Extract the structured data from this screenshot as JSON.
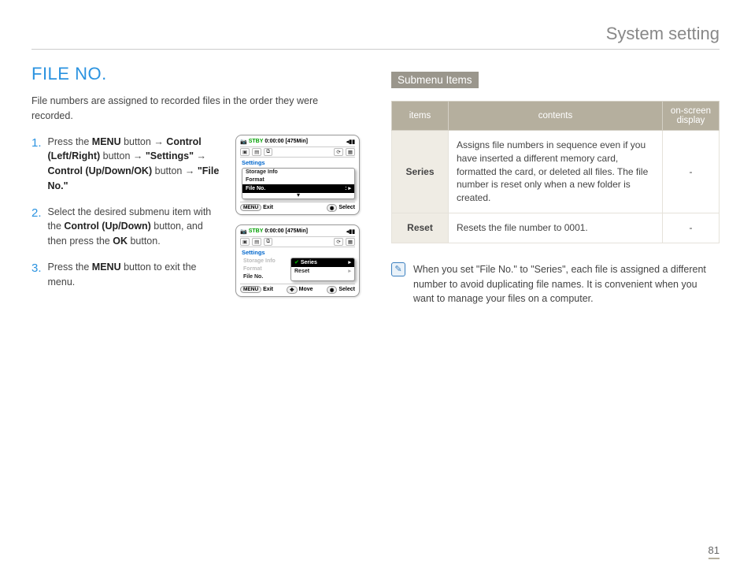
{
  "header": {
    "title": "System setting"
  },
  "section": {
    "title": "FILE NO."
  },
  "intro": "File numbers are assigned to recorded files in the order they were recorded.",
  "steps": [
    {
      "num": "1.",
      "pre": "Press the ",
      "b1": "MENU",
      "mid1": " button ",
      "arr1": "→",
      "b2": " Control (Left/Right)",
      "mid2": " button ",
      "arr2": "→",
      "q1": " \"Settings\" ",
      "arr3": "→",
      "b3": " Control (Up/Down/OK)",
      "mid3": " button ",
      "arr4": "→",
      "q2": " \"File No.\""
    },
    {
      "num": "2.",
      "text1": "Select the desired submenu item with the ",
      "b1": "Control (Up/Down)",
      "text2": " button, and then press the ",
      "b2": "OK",
      "text3": " button."
    },
    {
      "num": "3.",
      "text1": "Press the ",
      "b1": "MENU",
      "text2": " button to exit the menu."
    }
  ],
  "shot": {
    "stby": "STBY",
    "time": "0:00:00",
    "remain": "[475Min]",
    "settings": "Settings",
    "items": [
      "Storage Info",
      "Format",
      "File No."
    ],
    "submenu": [
      "Series",
      "Reset"
    ],
    "menu": "MENU",
    "exit": "Exit",
    "move": "Move",
    "select": "Select"
  },
  "submenu_hdr": "Submenu Items",
  "table": {
    "h1": "items",
    "h2": "contents",
    "h3": "on-screen display",
    "rows": [
      {
        "item": "Series",
        "content": "Assigns file numbers in sequence even if you have inserted a different memory card, formatted the card, or deleted all files. The file number is reset only when a new folder is created.",
        "disp": "-"
      },
      {
        "item": "Reset",
        "content": "Resets the file number to 0001.",
        "disp": "-"
      }
    ]
  },
  "note": "When you set \"File No.\" to \"Series\", each file is assigned a different number to avoid duplicating file names. It is convenient when you want to manage your files on a computer.",
  "pagenum": "81"
}
